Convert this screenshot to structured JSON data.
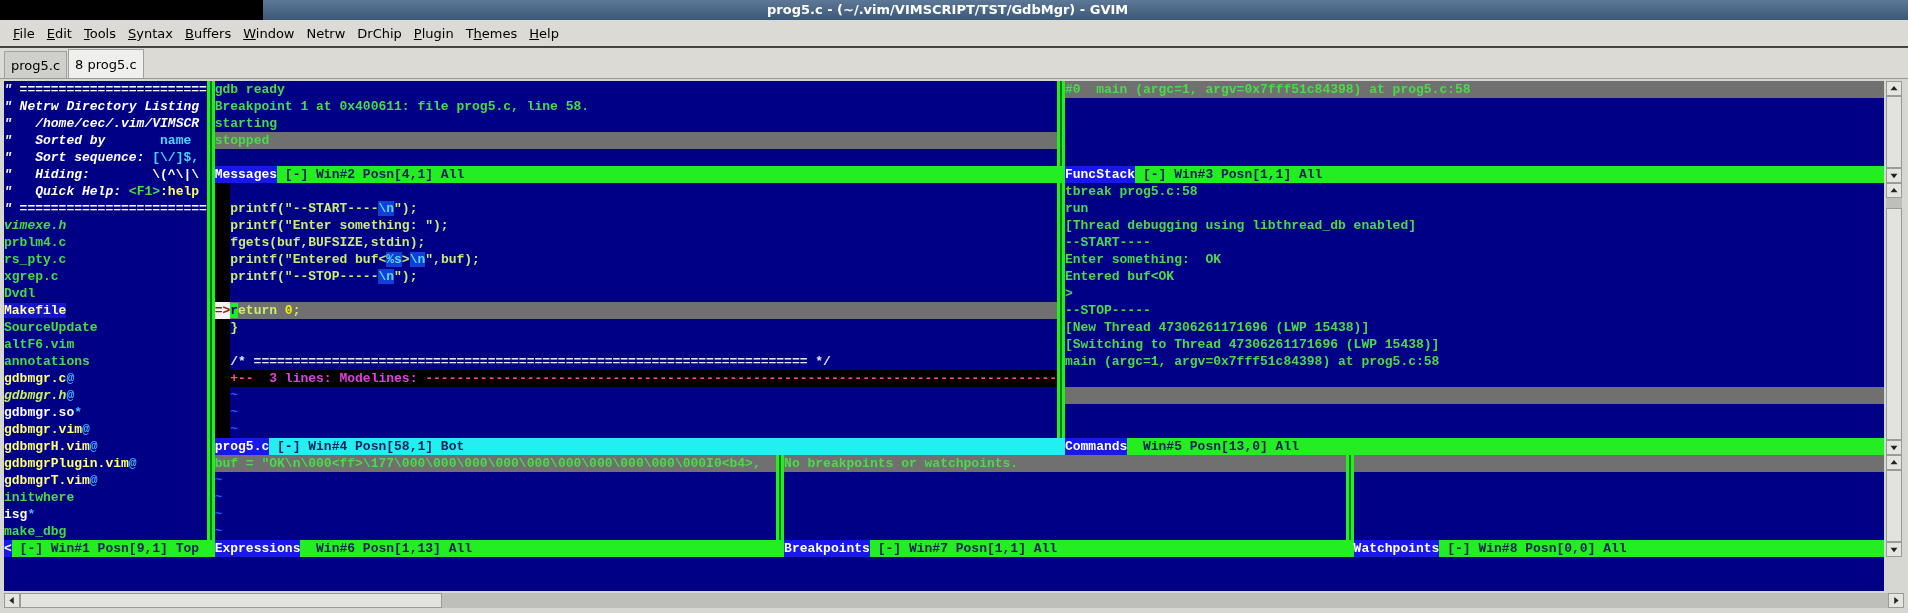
{
  "window": {
    "title": "prog5.c - (~/.vim/VIMSCRIPT/TST/GdbMgr) - GVIM"
  },
  "menu": [
    {
      "key": "F",
      "post": "ile"
    },
    {
      "key": "E",
      "post": "dit"
    },
    {
      "key": "T",
      "post": "ools"
    },
    {
      "key": "S",
      "post": "yntax"
    },
    {
      "key": "B",
      "post": "uffers"
    },
    {
      "key": "W",
      "post": "indow"
    },
    {
      "pre": "Netrw"
    },
    {
      "pre": "DrChip"
    },
    {
      "key": "P",
      "post": "lugin"
    },
    {
      "pre": "T",
      "key": "h",
      "post": "emes"
    },
    {
      "key": "H",
      "post": "elp"
    }
  ],
  "tabs": [
    {
      "label": "prog5.c",
      "selected": false
    },
    {
      "label": "8 prog5.c",
      "selected": true
    }
  ],
  "netrw": {
    "lines": [
      {
        "segments": [
          {
            "text": "\" ========================",
            "kind": "comment"
          }
        ]
      },
      {
        "segments": [
          {
            "text": "\" Netrw Directory Listing",
            "kind": "comment"
          }
        ]
      },
      {
        "segments": [
          {
            "text": "\"   /home/cec/.vim/VIMSCR",
            "kind": "comment"
          }
        ]
      },
      {
        "segments": [
          {
            "text": "\"   Sorted by       ",
            "kind": "comment"
          },
          {
            "text": "name",
            "kind": "value"
          }
        ]
      },
      {
        "segments": [
          {
            "text": "\"   Sort sequence: ",
            "kind": "comment"
          },
          {
            "text": "[\\/]$,",
            "kind": "value"
          }
        ]
      },
      {
        "segments": [
          {
            "text": "\"   Hiding:        ",
            "kind": "comment"
          },
          {
            "text": "\\(^\\|\\",
            "kind": "plain"
          }
        ]
      },
      {
        "segments": [
          {
            "text": "\"   Quick Help: ",
            "kind": "comment"
          },
          {
            "text": "<F1>",
            "kind": "key"
          },
          {
            "text": ":help",
            "kind": "help"
          }
        ]
      },
      {
        "segments": [
          {
            "text": "\" ========================",
            "kind": "comment"
          }
        ]
      },
      {
        "segments": [
          {
            "text": "vimexe.h",
            "kind": "header-file"
          }
        ]
      },
      {
        "segments": [
          {
            "text": "prblm4.c",
            "kind": "file"
          }
        ]
      },
      {
        "segments": [
          {
            "text": "rs_pty.c",
            "kind": "file"
          }
        ]
      },
      {
        "segments": [
          {
            "text": "xgrep.c",
            "kind": "file"
          }
        ]
      },
      {
        "segments": [
          {
            "text": "Dvdl",
            "kind": "file"
          }
        ]
      },
      {
        "segments": [
          {
            "text": "Makefile",
            "kind": "make"
          }
        ]
      },
      {
        "segments": [
          {
            "text": "SourceUpdate",
            "kind": "file"
          }
        ]
      },
      {
        "segments": [
          {
            "text": "altF6.vim",
            "kind": "file"
          }
        ]
      },
      {
        "segments": [
          {
            "text": "annotations",
            "kind": "file"
          }
        ]
      },
      {
        "segments": [
          {
            "text": "gdbmgr.c",
            "kind": "link"
          },
          {
            "text": "@",
            "kind": "mark"
          }
        ]
      },
      {
        "segments": [
          {
            "text": "gdbmgr.h",
            "kind": "header-link"
          },
          {
            "text": "@",
            "kind": "mark"
          }
        ]
      },
      {
        "segments": [
          {
            "text": "gdbmgr.so",
            "kind": "exe"
          },
          {
            "text": "*",
            "kind": "mark"
          }
        ]
      },
      {
        "segments": [
          {
            "text": "gdbmgr.vim",
            "kind": "link"
          },
          {
            "text": "@",
            "kind": "mark"
          }
        ]
      },
      {
        "segments": [
          {
            "text": "gdbmgrH.vim",
            "kind": "link"
          },
          {
            "text": "@",
            "kind": "mark"
          }
        ]
      },
      {
        "segments": [
          {
            "text": "gdbmgrPlugin.vim",
            "kind": "link"
          },
          {
            "text": "@",
            "kind": "mark"
          }
        ]
      },
      {
        "segments": [
          {
            "text": "gdbmgrT.vim",
            "kind": "link"
          },
          {
            "text": "@",
            "kind": "mark"
          }
        ]
      },
      {
        "segments": [
          {
            "text": "initwhere",
            "kind": "file"
          }
        ]
      },
      {
        "segments": [
          {
            "text": "isg",
            "kind": "exe"
          },
          {
            "text": "*",
            "kind": "mark"
          }
        ]
      },
      {
        "segments": [
          {
            "text": "make_dbg",
            "kind": "file"
          }
        ]
      }
    ],
    "status": {
      "name": "<",
      "flag": "[-]",
      "info": "Win#1 Posn[9,1] Top",
      "active": false
    }
  },
  "messages": {
    "lines": [
      {
        "text": "gdb ready",
        "highlighted": false
      },
      {
        "text": "Breakpoint 1 at 0x400611: file prog5.c, line 58.",
        "highlighted": false
      },
      {
        "text": "starting",
        "highlighted": false
      },
      {
        "text": "stopped",
        "highlighted": true
      },
      {
        "highlighted": false
      }
    ],
    "status": {
      "name": "Messages",
      "flag": "[-]",
      "info": "Win#2 Posn[4,1] All",
      "active": false
    }
  },
  "funcstack": {
    "lines": [
      {
        "text": "#0  main (argc=1, argv=0x7fff51c84398) at prog5.c:58",
        "highlighted": true
      }
    ],
    "status": {
      "name": "FuncStack",
      "flag": "[-]",
      "info": "Win#3 Posn[1,1] All",
      "active": false
    }
  },
  "source": {
    "lines": [
      {
        "kind": "blank",
        "highlighted": false
      },
      {
        "kind": "code",
        "highlighted": false,
        "segments": [
          {
            "text": "printf(\"--START----",
            "kind": "plain"
          },
          {
            "text": "\\n",
            "kind": "special"
          },
          {
            "text": "\");",
            "kind": "plain"
          }
        ]
      },
      {
        "kind": "code",
        "highlighted": false,
        "segments": [
          {
            "text": "printf(\"Enter something: \");",
            "kind": "plain"
          }
        ]
      },
      {
        "kind": "code",
        "highlighted": false,
        "segments": [
          {
            "text": "fgets(buf,BUFSIZE,stdin);",
            "kind": "plain"
          }
        ]
      },
      {
        "kind": "code",
        "highlighted": false,
        "segments": [
          {
            "text": "printf(\"Entered buf<",
            "kind": "plain"
          },
          {
            "text": "%s",
            "kind": "special"
          },
          {
            "text": ">",
            "kind": "plain"
          },
          {
            "text": "\\n",
            "kind": "special"
          },
          {
            "text": "\",buf);",
            "kind": "plain"
          }
        ]
      },
      {
        "kind": "code",
        "highlighted": false,
        "segments": [
          {
            "text": "printf(\"--STOP-----",
            "kind": "plain"
          },
          {
            "text": "\\n",
            "kind": "special"
          },
          {
            "text": "\");",
            "kind": "plain"
          }
        ]
      },
      {
        "kind": "blank",
        "highlighted": false
      },
      {
        "kind": "code",
        "highlighted": true,
        "sign": "=>",
        "segments": [
          {
            "text": "r",
            "kind": "cursor"
          },
          {
            "text": "eturn ",
            "kind": "plain"
          },
          {
            "text": "0",
            "kind": "number"
          },
          {
            "text": ";",
            "kind": "plain"
          }
        ]
      },
      {
        "kind": "code",
        "highlighted": false,
        "segments": [
          {
            "text": "}",
            "kind": "plain"
          }
        ]
      },
      {
        "kind": "blank",
        "highlighted": false
      },
      {
        "kind": "code",
        "highlighted": false,
        "segments": [
          {
            "text": "/* ======================================================================= */",
            "kind": "comment"
          }
        ]
      },
      {
        "kind": "fold",
        "segments": [
          {
            "text": "+--  ",
            "kind": "fold-dash"
          },
          {
            "text": "3 lines: Modelines: ",
            "kind": "fold-text"
          },
          {
            "text": "---------------------------------------------------------------------------------",
            "kind": "fold-dash"
          }
        ]
      },
      {
        "kind": "filler",
        "highlighted": false,
        "text": "~"
      },
      {
        "kind": "filler",
        "highlighted": false,
        "text": "~"
      },
      {
        "kind": "filler",
        "highlighted": false,
        "text": "~"
      }
    ],
    "status": {
      "name": "prog5.c",
      "flag": "[-]",
      "info": "Win#4 Posn[58,1] Bot",
      "active": true
    }
  },
  "commands": {
    "lines": [
      {
        "text": "tbreak prog5.c:58",
        "highlighted": false
      },
      {
        "text": "run",
        "highlighted": false
      },
      {
        "text": "[Thread debugging using libthread_db enabled]",
        "highlighted": false
      },
      {
        "text": "--START----",
        "highlighted": false
      },
      {
        "text": "Enter something:  OK",
        "highlighted": false
      },
      {
        "text": "Entered buf<OK",
        "highlighted": false
      },
      {
        "text": ">",
        "highlighted": false
      },
      {
        "text": "--STOP-----",
        "highlighted": false
      },
      {
        "text": "[New Thread 47306261171696 (LWP 15438)]",
        "highlighted": false
      },
      {
        "text": "[Switching to Thread 47306261171696 (LWP 15438)]",
        "highlighted": false
      },
      {
        "text": "main (argc=1, argv=0x7fff51c84398) at prog5.c:58",
        "highlighted": false
      },
      {
        "highlighted": false
      },
      {
        "highlighted": true
      }
    ],
    "status": {
      "name": "Commands",
      "info": "Win#5 Posn[13,0] All",
      "active": false
    }
  },
  "expressions": {
    "lines": [
      {
        "text": "buf = \"OK\\n\\000<ff>\\177\\000\\000\\000\\000\\000\\000\\000\\000\\000\\000I0<b4>,",
        "highlighted": true
      }
    ],
    "fillers": [
      "~",
      "~",
      "~",
      "~"
    ],
    "status": {
      "name": "Expressions",
      "info": "Win#6 Posn[1,13] All",
      "active": false
    }
  },
  "breakpoints": {
    "lines": [
      {
        "text": "No breakpoints or watchpoints.",
        "highlighted": true
      }
    ],
    "status": {
      "name": "Breakpoints",
      "flag": "[-]",
      "info": "Win#7 Posn[1,1] All",
      "active": false
    }
  },
  "watchpoints": {
    "lines": [
      {
        "highlighted": true
      }
    ],
    "status": {
      "name": "Watchpoints",
      "flag": "[-]",
      "info": "Win#8 Posn[0,0] All",
      "active": false
    }
  }
}
